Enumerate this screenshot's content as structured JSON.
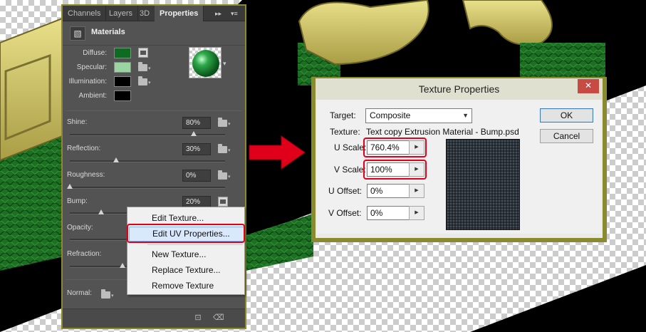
{
  "panel": {
    "tabs": [
      "Channels",
      "Layers",
      "3D",
      "Properties"
    ],
    "collapse_glyph": "▸▸",
    "menu_glyph": "▾≡",
    "title": "Materials",
    "swatches": [
      {
        "label": "Diffuse:",
        "color": "#0f6b22"
      },
      {
        "label": "Specular:",
        "color": "#9bd3a3"
      },
      {
        "label": "Illumination:",
        "color": "#000000"
      },
      {
        "label": "Ambient:",
        "color": "#000000"
      }
    ],
    "sliders": [
      {
        "label": "Shine:",
        "value": "80%",
        "fraction": 0.8
      },
      {
        "label": "Reflection:",
        "value": "30%",
        "fraction": 0.3
      },
      {
        "label": "Roughness:",
        "value": "0%",
        "fraction": 0.0
      },
      {
        "label": "Bump:",
        "value": "20%",
        "fraction": 0.2
      },
      {
        "label": "Opacity:"
      },
      {
        "label": "Refraction:"
      }
    ],
    "normal_label": "Normal:"
  },
  "context_menu": {
    "items": [
      "Edit Texture...",
      "Edit UV Properties...",
      "New Texture...",
      "Replace Texture...",
      "Remove Texture"
    ],
    "highlighted": "Edit UV Properties..."
  },
  "dialog": {
    "title": "Texture Properties",
    "close_glyph": "✕",
    "target_label": "Target:",
    "target_value": "Composite",
    "texture_label": "Texture:",
    "texture_name": "Text copy Extrusion Material - Bump.psd",
    "fields": [
      {
        "label": "U Scale:",
        "value": "760.4%"
      },
      {
        "label": "V Scale:",
        "value": "100%"
      },
      {
        "label": "U Offset:",
        "value": "0%"
      },
      {
        "label": "V Offset:",
        "value": "0%"
      }
    ],
    "ok_label": "OK",
    "cancel_label": "Cancel"
  },
  "colors": {
    "panel_bg": "#535353",
    "highlight_red": "#e0001a",
    "arrow_red": "#e0001a",
    "gold": "#c9c06a",
    "green": "#1f7a26",
    "dialog_frame": "#8a8a2e"
  },
  "icons": [
    "materials-icon",
    "folder-icon",
    "texture-edit-icon",
    "red-arrow-icon",
    "close-icon",
    "delete-icon",
    "new-icon"
  ]
}
